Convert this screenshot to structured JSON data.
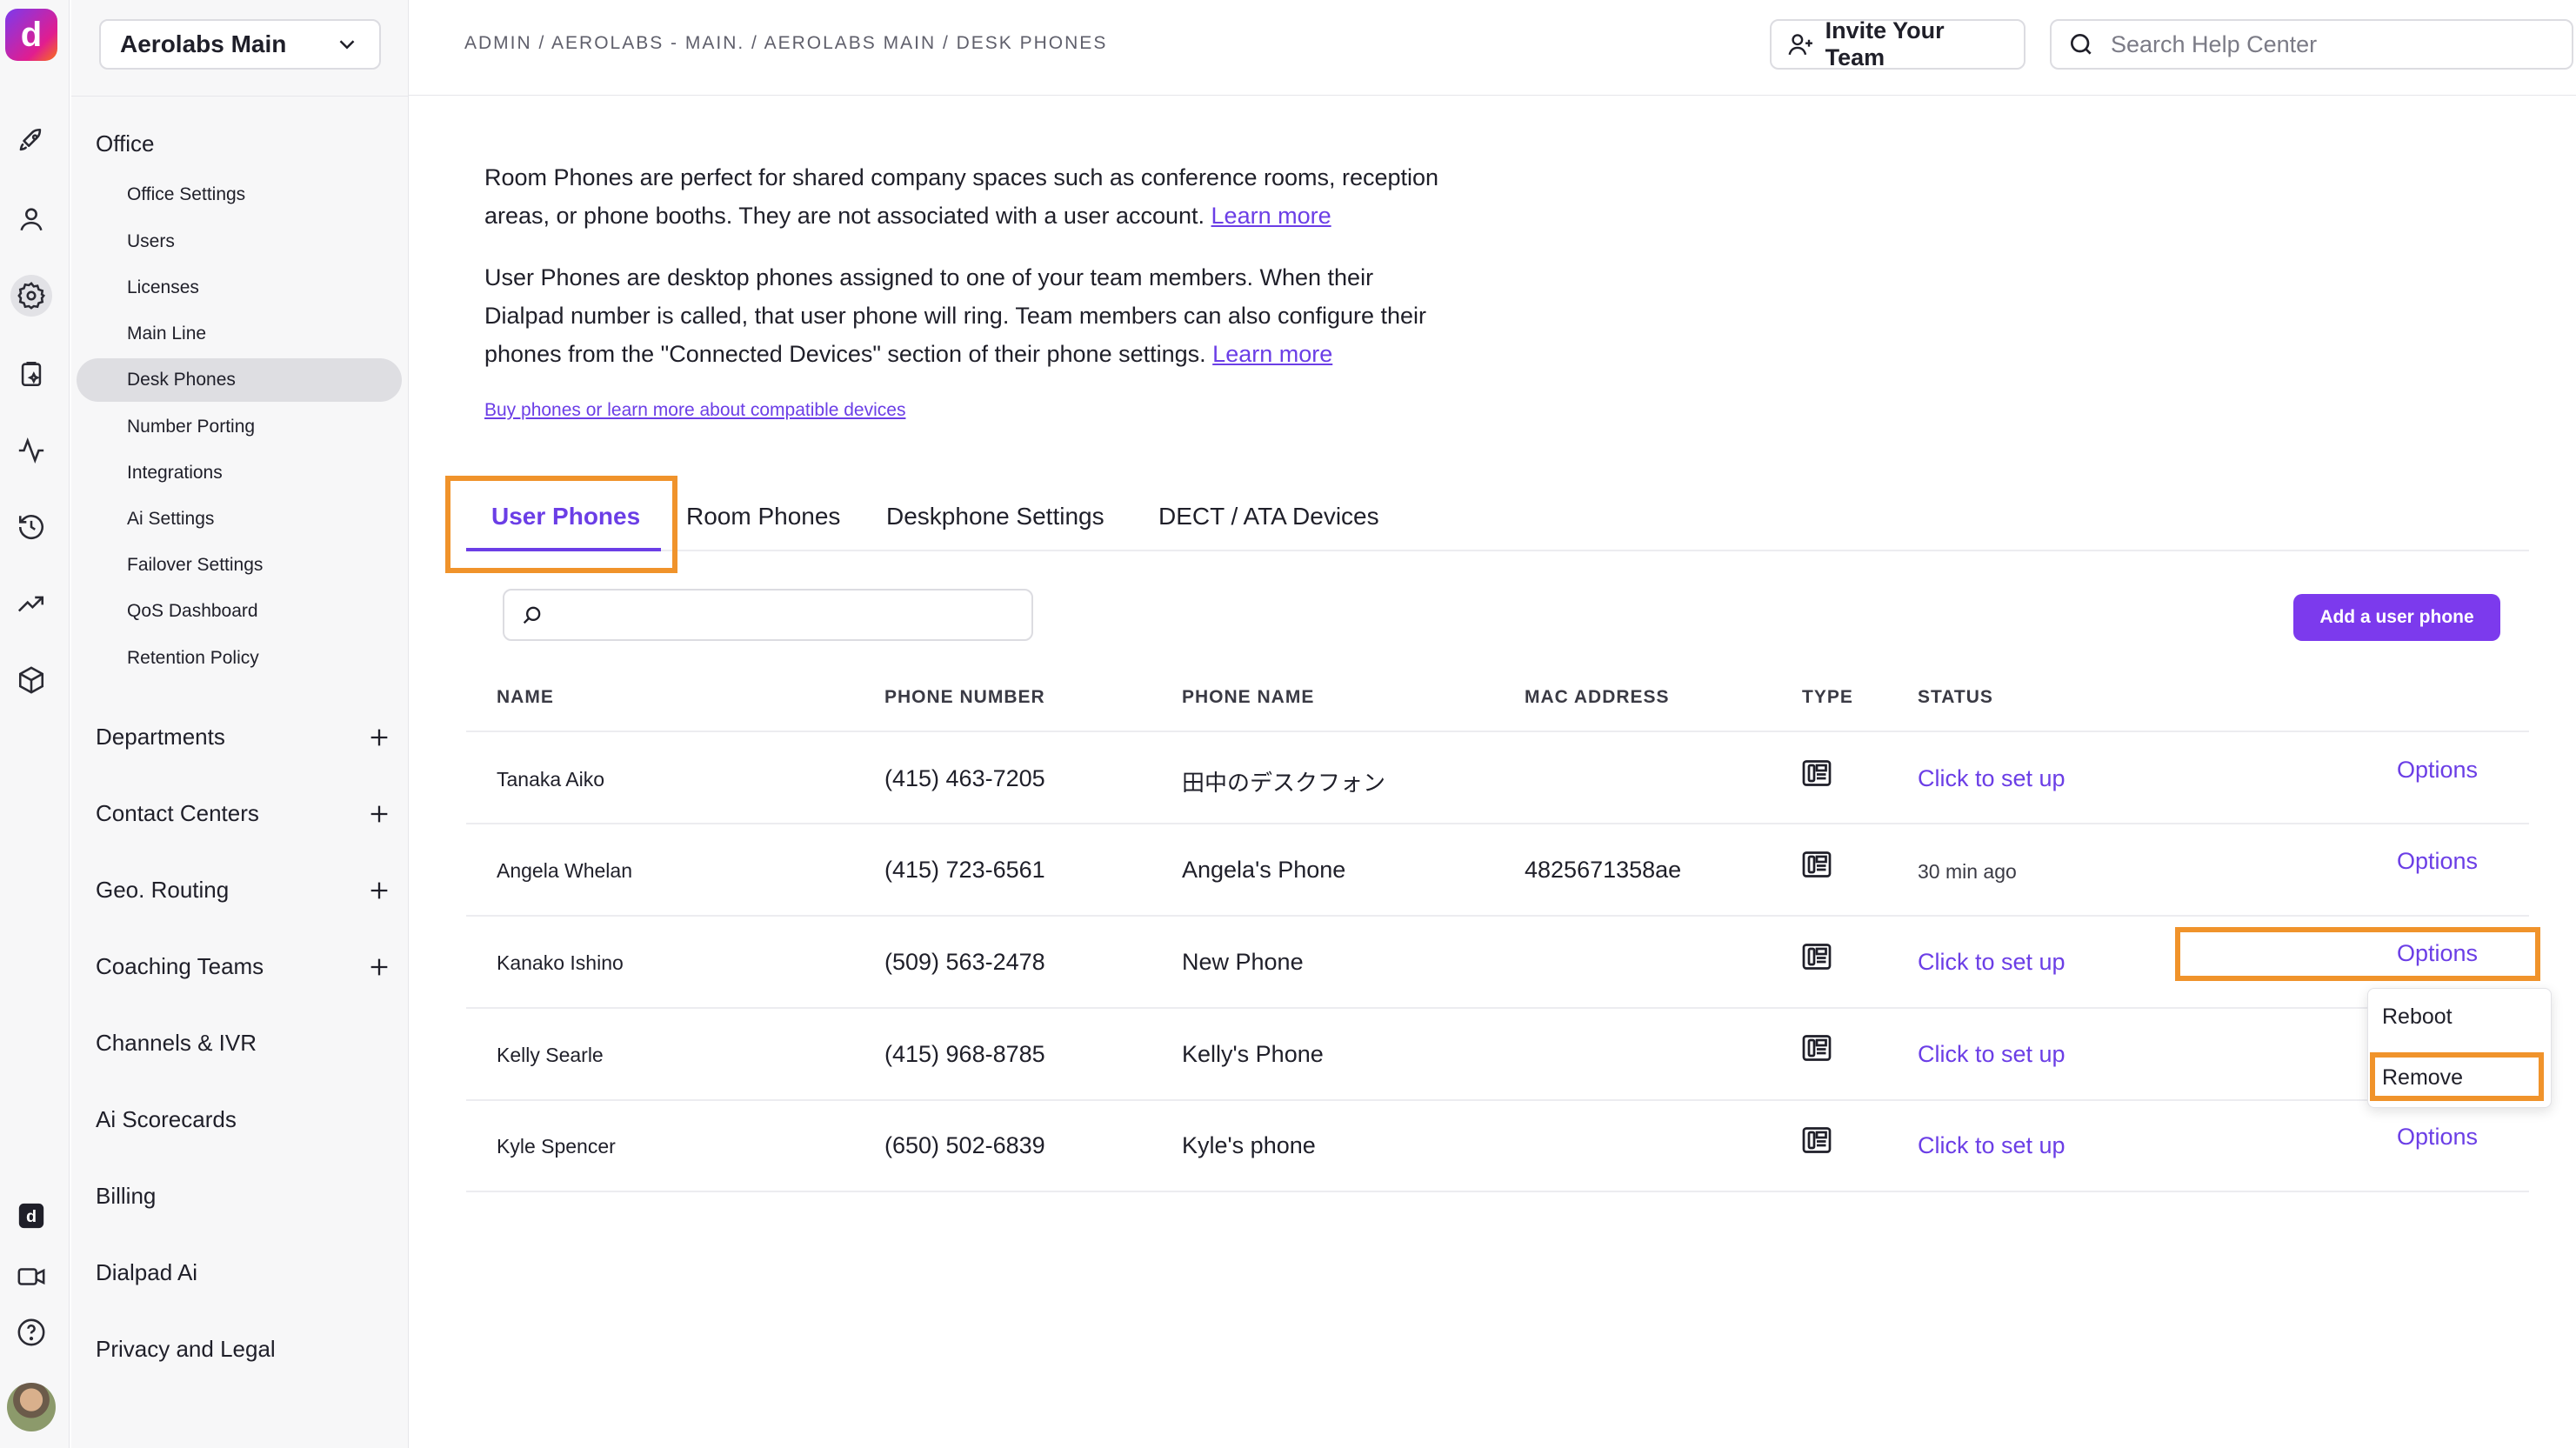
{
  "rail": {
    "logo_text": "d",
    "icons": [
      "rocket-icon",
      "user-icon",
      "gear-icon",
      "clipboard-icon",
      "activity-icon",
      "history-icon",
      "trending-icon",
      "cube-icon",
      "dialpad-icon",
      "video-icon",
      "help-icon"
    ],
    "active_icon": "gear-icon"
  },
  "sidebar": {
    "org_name": "Aerolabs Main",
    "section_title": "Office",
    "sub_items": [
      {
        "label": "Office Settings"
      },
      {
        "label": "Users"
      },
      {
        "label": "Licenses"
      },
      {
        "label": "Main Line"
      },
      {
        "label": "Desk Phones",
        "active": true
      },
      {
        "label": "Number Porting"
      },
      {
        "label": "Integrations"
      },
      {
        "label": "Ai Settings"
      },
      {
        "label": "Failover Settings"
      },
      {
        "label": "QoS Dashboard"
      },
      {
        "label": "Retention Policy"
      }
    ],
    "groups": [
      {
        "label": "Departments",
        "expandable": true
      },
      {
        "label": "Contact Centers",
        "expandable": true
      },
      {
        "label": "Geo. Routing",
        "expandable": true
      },
      {
        "label": "Coaching Teams",
        "expandable": true
      },
      {
        "label": "Channels & IVR",
        "expandable": false
      },
      {
        "label": "Ai Scorecards",
        "expandable": false
      },
      {
        "label": "Billing",
        "expandable": false
      },
      {
        "label": "Dialpad Ai",
        "expandable": false
      },
      {
        "label": "Privacy and Legal",
        "expandable": false
      }
    ]
  },
  "header": {
    "breadcrumb": "ADMIN / AEROLABS - MAIN. / AEROLABS MAIN / DESK PHONES",
    "invite_label": "Invite Your Team",
    "search_placeholder": "Search Help Center"
  },
  "intro": {
    "room_line1": "Room Phones are perfect for shared company spaces such as conference rooms, reception",
    "room_line2": "areas, or phone booths. They are not associated with a user account.",
    "room_link": "Learn more",
    "user_line1": "User Phones are desktop phones assigned to one of your team members. When their",
    "user_line2": "Dialpad number is called, that user phone will ring. Team members can also configure their",
    "user_line3": "phones from the \"Connected Devices\" section of their phone settings.",
    "user_link": "Learn more",
    "buy_link": "Buy phones or learn more about compatible devices"
  },
  "tabs": [
    {
      "label": "User Phones",
      "active": true
    },
    {
      "label": "Room Phones"
    },
    {
      "label": "Deskphone Settings"
    },
    {
      "label": "DECT / ATA Devices"
    }
  ],
  "table": {
    "search_value": "",
    "add_button": "Add a user phone",
    "columns": [
      "NAME",
      "PHONE NUMBER",
      "PHONE NAME",
      "MAC ADDRESS",
      "TYPE",
      "STATUS"
    ],
    "rows": [
      {
        "name": "Tanaka Aiko",
        "phone": "(415) 463-7205",
        "phone_name": "田中のデスクフォン",
        "mac": "",
        "type": "desk-phone-icon",
        "status": "Click to set up",
        "status_link": true,
        "options": "Options"
      },
      {
        "name": "Angela Whelan",
        "phone": "(415) 723-6561",
        "phone_name": "Angela's Phone",
        "mac": "4825671358ae",
        "type": "desk-phone-icon",
        "status": "30 min ago",
        "status_link": false,
        "options": "Options"
      },
      {
        "name": "Kanako Ishino",
        "phone": "(509) 563-2478",
        "phone_name": "New Phone",
        "mac": "",
        "type": "desk-phone-icon",
        "status": "Click to set up",
        "status_link": true,
        "options": "Options"
      },
      {
        "name": "Kelly Searle",
        "phone": "(415) 968-8785",
        "phone_name": "Kelly's Phone",
        "mac": "",
        "type": "desk-phone-icon",
        "status": "Click to set up",
        "status_link": true,
        "options": ""
      },
      {
        "name": "Kyle Spencer",
        "phone": "(650) 502-6839",
        "phone_name": "Kyle's phone",
        "mac": "",
        "type": "desk-phone-icon",
        "status": "Click to set up",
        "status_link": true,
        "options": "Options"
      }
    ]
  },
  "options_menu": {
    "items": [
      "Reboot",
      "Remove"
    ]
  },
  "colors": {
    "accent": "#6b3ee6",
    "button": "#7c3aed",
    "highlight": "#f0932b"
  }
}
